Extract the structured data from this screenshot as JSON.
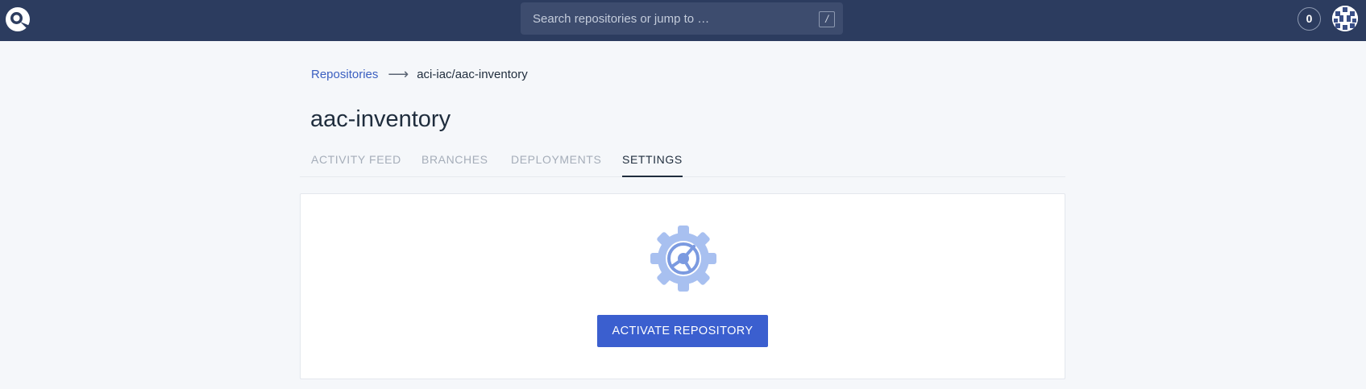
{
  "topbar": {
    "search_placeholder": "Search repositories or jump to …",
    "search_shortcut": "/",
    "notification_count": "0"
  },
  "breadcrumb": {
    "root": "Repositories",
    "current": "aci-iac/aac-inventory"
  },
  "page": {
    "title": "aac-inventory"
  },
  "tabs": [
    {
      "label": "ACTIVITY FEED",
      "active": false
    },
    {
      "label": "BRANCHES",
      "active": false
    },
    {
      "label": "DEPLOYMENTS",
      "active": false
    },
    {
      "label": "SETTINGS",
      "active": true
    }
  ],
  "card": {
    "icon": "gear-icon",
    "button_label": "ACTIVATE REPOSITORY"
  },
  "colors": {
    "topbar": "#2c3c5f",
    "accent": "#3b5fcf",
    "link": "#3b5fc0"
  }
}
